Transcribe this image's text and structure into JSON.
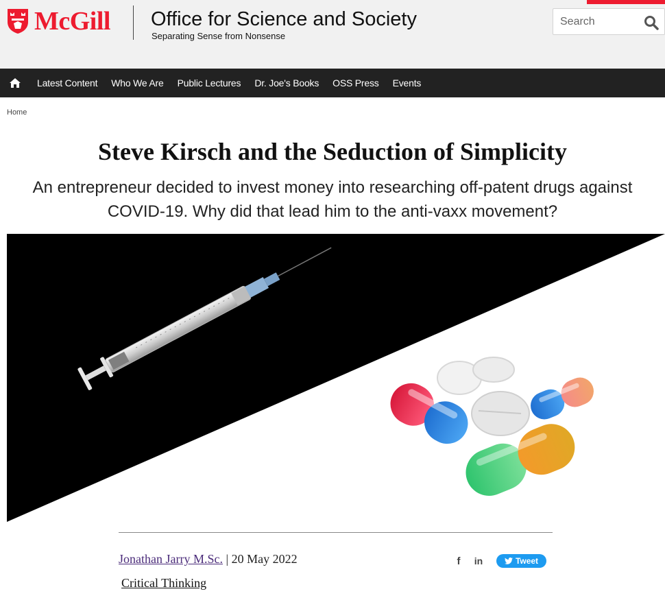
{
  "header": {
    "wordmark": "McGill",
    "site_title": "Office for Science and Society",
    "tagline": "Separating Sense from Nonsense",
    "search_placeholder": "Search",
    "brand_red": "#ed1b2f"
  },
  "nav": {
    "home_icon": "home-icon",
    "items": [
      "Latest Content",
      "Who We Are",
      "Public Lectures",
      "Dr. Joe's Books",
      "OSS Press",
      "Events"
    ]
  },
  "breadcrumb": {
    "home": "Home"
  },
  "article": {
    "title": "Steve Kirsch and the Seduction of Simplicity",
    "subtitle": "An entrepreneur decided to invest money into researching off-patent drugs against COVID-19. Why did that lead him to the anti-vaxx movement?",
    "hero_image": "syringe-and-pills-illustration",
    "author": "Jonathan Jarry M.Sc.",
    "separator": " | ",
    "date": "20 May 2022",
    "category": "Critical Thinking"
  },
  "share": {
    "facebook": "f",
    "linkedin": "in",
    "tweet_label": "Tweet"
  }
}
